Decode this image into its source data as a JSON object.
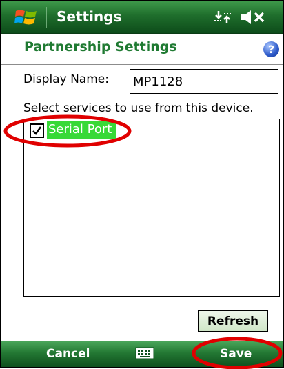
{
  "titlebar": {
    "title": "Settings",
    "icons": [
      "windows-start-icon",
      "connectivity-icon",
      "volume-mute-icon"
    ]
  },
  "header": {
    "title": "Partnership Settings",
    "help_glyph": "?"
  },
  "form": {
    "display_name_label": "Display Name:",
    "display_name_value": "MP1128",
    "services_label": "Select services to use from this device.",
    "services": [
      {
        "label": "Serial Port",
        "checked": true
      }
    ]
  },
  "buttons": {
    "refresh": "Refresh"
  },
  "softkeys": {
    "left": "Cancel",
    "right": "Save",
    "center_icon": "keyboard-icon"
  },
  "colors": {
    "title_green": "#1f6e2c",
    "header_text": "#1f7a32",
    "selection": "#37d937",
    "annotation_red": "#e00000"
  }
}
